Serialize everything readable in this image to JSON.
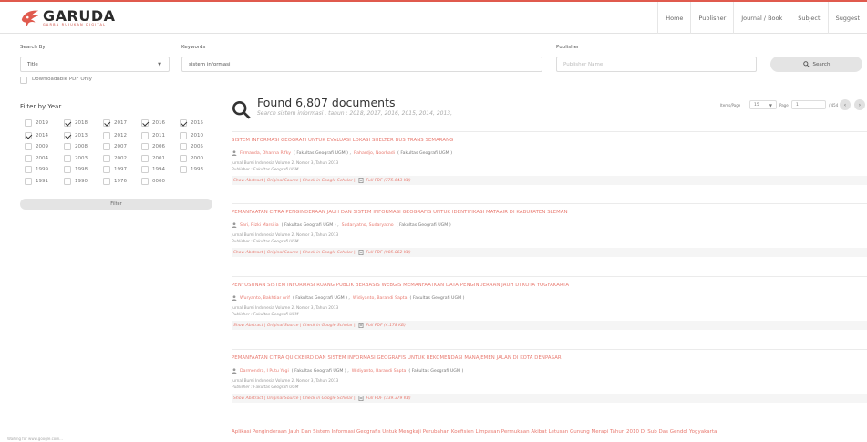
{
  "brand": {
    "name": "GARUDA",
    "tagline": "GARBA RUJUKAN DIGITAL",
    "accent": "#e05a4e",
    "link_color": "#e8796f"
  },
  "nav": [
    "Home",
    "Publisher",
    "Journal / Book",
    "Subject",
    "Suggest"
  ],
  "search": {
    "search_by_label": "Search By",
    "search_by_value": "Title",
    "keywords_label": "Keywords",
    "keywords_value": "sistem informasi",
    "publisher_label": "Publisher",
    "publisher_placeholder": "Publisher Name",
    "button_label": "Search",
    "pdf_label": "Downloadable PDF Only"
  },
  "filter": {
    "title": "Filter by Year",
    "button_label": "Filter",
    "years": [
      {
        "year": "2019",
        "checked": false
      },
      {
        "year": "2018",
        "checked": true
      },
      {
        "year": "2017",
        "checked": true
      },
      {
        "year": "2016",
        "checked": true
      },
      {
        "year": "2015",
        "checked": true
      },
      {
        "year": "2014",
        "checked": true
      },
      {
        "year": "2013",
        "checked": true
      },
      {
        "year": "2012",
        "checked": false
      },
      {
        "year": "2011",
        "checked": false
      },
      {
        "year": "2010",
        "checked": false
      },
      {
        "year": "2009",
        "checked": false
      },
      {
        "year": "2008",
        "checked": false
      },
      {
        "year": "2007",
        "checked": false
      },
      {
        "year": "2006",
        "checked": false
      },
      {
        "year": "2005",
        "checked": false
      },
      {
        "year": "2004",
        "checked": false
      },
      {
        "year": "2003",
        "checked": false
      },
      {
        "year": "2002",
        "checked": false
      },
      {
        "year": "2001",
        "checked": false
      },
      {
        "year": "2000",
        "checked": false
      },
      {
        "year": "1999",
        "checked": false
      },
      {
        "year": "1998",
        "checked": false
      },
      {
        "year": "1997",
        "checked": false
      },
      {
        "year": "1994",
        "checked": false
      },
      {
        "year": "1993",
        "checked": false
      },
      {
        "year": "1991",
        "checked": false
      },
      {
        "year": "1990",
        "checked": false
      },
      {
        "year": "1976",
        "checked": false
      },
      {
        "year": "0000",
        "checked": false
      }
    ]
  },
  "results": {
    "found": "Found 6,807 documents",
    "subtitle": "Search sistem informasi , tahun : 2018, 2017, 2016, 2015, 2014, 2013,",
    "items_per_page_label": "Items/Page",
    "items_per_page": "15",
    "page_label": "Page",
    "page": "1",
    "page_total": "/ 454",
    "prev": "‹",
    "next": "›",
    "items": [
      {
        "title": "SISTEM INFORMASI GEOGRAFI UNTUK EVALUASI LOKASI SHELTER BUS TRANS SEMARANG",
        "authors": [
          "Firmanda, Dhanna Rifky",
          "( Fakultas Geografi UGM ) ,",
          "Rahardjo, Noorhadi",
          "( Fakultas Geografi UGM )"
        ],
        "journal": "Jurnal Bumi Indonesia Volume 2, Nomor 3, Tahun 2013",
        "publisher": "Publisher : Fakultas Geografi UGM",
        "actions": "Show Abstract | Original Source | Check in Google Scholar |",
        "pdf": "Full PDF (775.643 KB)"
      },
      {
        "title": "PEMANFAATAN CITRA PENGINDERAAN JAUH DAN SISTEM INFORMASI GEOGRAFIS UNTUK IDENTIFIKASI MATAAIR DI KABUPATEN SLEMAN",
        "authors": [
          "Sari, Rizki Marsilia",
          "( Fakultas Geografi UGM ) ,",
          "Sudaryatno, Sudaryatno",
          "( Fakultas Geografi UGM )"
        ],
        "journal": "Jurnal Bumi Indonesia Volume 2, Nomor 3, Tahun 2013",
        "publisher": "Publisher : Fakultas Geografi UGM",
        "actions": "Show Abstract | Original Source | Check in Google Scholar |",
        "pdf": "Full PDF (905.062 KB)"
      },
      {
        "title": "PENYUSUNAN SISTEM INFORMASI RUANG PUBLIK BERBASIS WEBGIS MEMANFAATKAN DATA PENGINDERAAN JAUH DI KOTA YOGYAKARTA",
        "authors": [
          "Wuryanto, Bakhtiar Arif",
          "( Fakultas Geografi UGM ) ,",
          "Widiyanto, Barandi Sapta",
          "( Fakultas Geografi UGM )"
        ],
        "journal": "Jurnal Bumi Indonesia Volume 2, Nomor 3, Tahun 2013",
        "publisher": "Publisher : Fakultas Geografi UGM",
        "actions": "Show Abstract | Original Source | Check in Google Scholar |",
        "pdf": "Full PDF (4.178 KB)"
      },
      {
        "title": "PEMANFAATAN CITRA QUICKBIRD DAN SISTEM INFORMASI GEOGRAFIS UNTUK REKOMENDASI MANAJEMEN JALAN DI KOTA DENPASAR",
        "authors": [
          "Darmendra, I Putu Yogi",
          "( Fakultas Geografi UGM ) ,",
          "Widiyanto, Barandi Sapta",
          "( Fakultas Geografi UGM )"
        ],
        "journal": "Jurnal Bumi Indonesia Volume 2, Nomor 3, Tahun 2013",
        "publisher": "Publisher : Fakultas Geografi UGM",
        "actions": "Show Abstract | Original Source | Check in Google Scholar |",
        "pdf": "Full PDF (339.379 KB)"
      }
    ],
    "next_title": "Aplikasi Penginderaan Jauh Dan Sistem Informasi Geografis Untuk Mengkaji Perubahan Koefisien Limpasan Permukaan Akibat Letusan Gunung Merapi Tahun 2010 Di Sub Das Gendol Yogyakarta"
  },
  "status_text": "Waiting for www.google.com..."
}
